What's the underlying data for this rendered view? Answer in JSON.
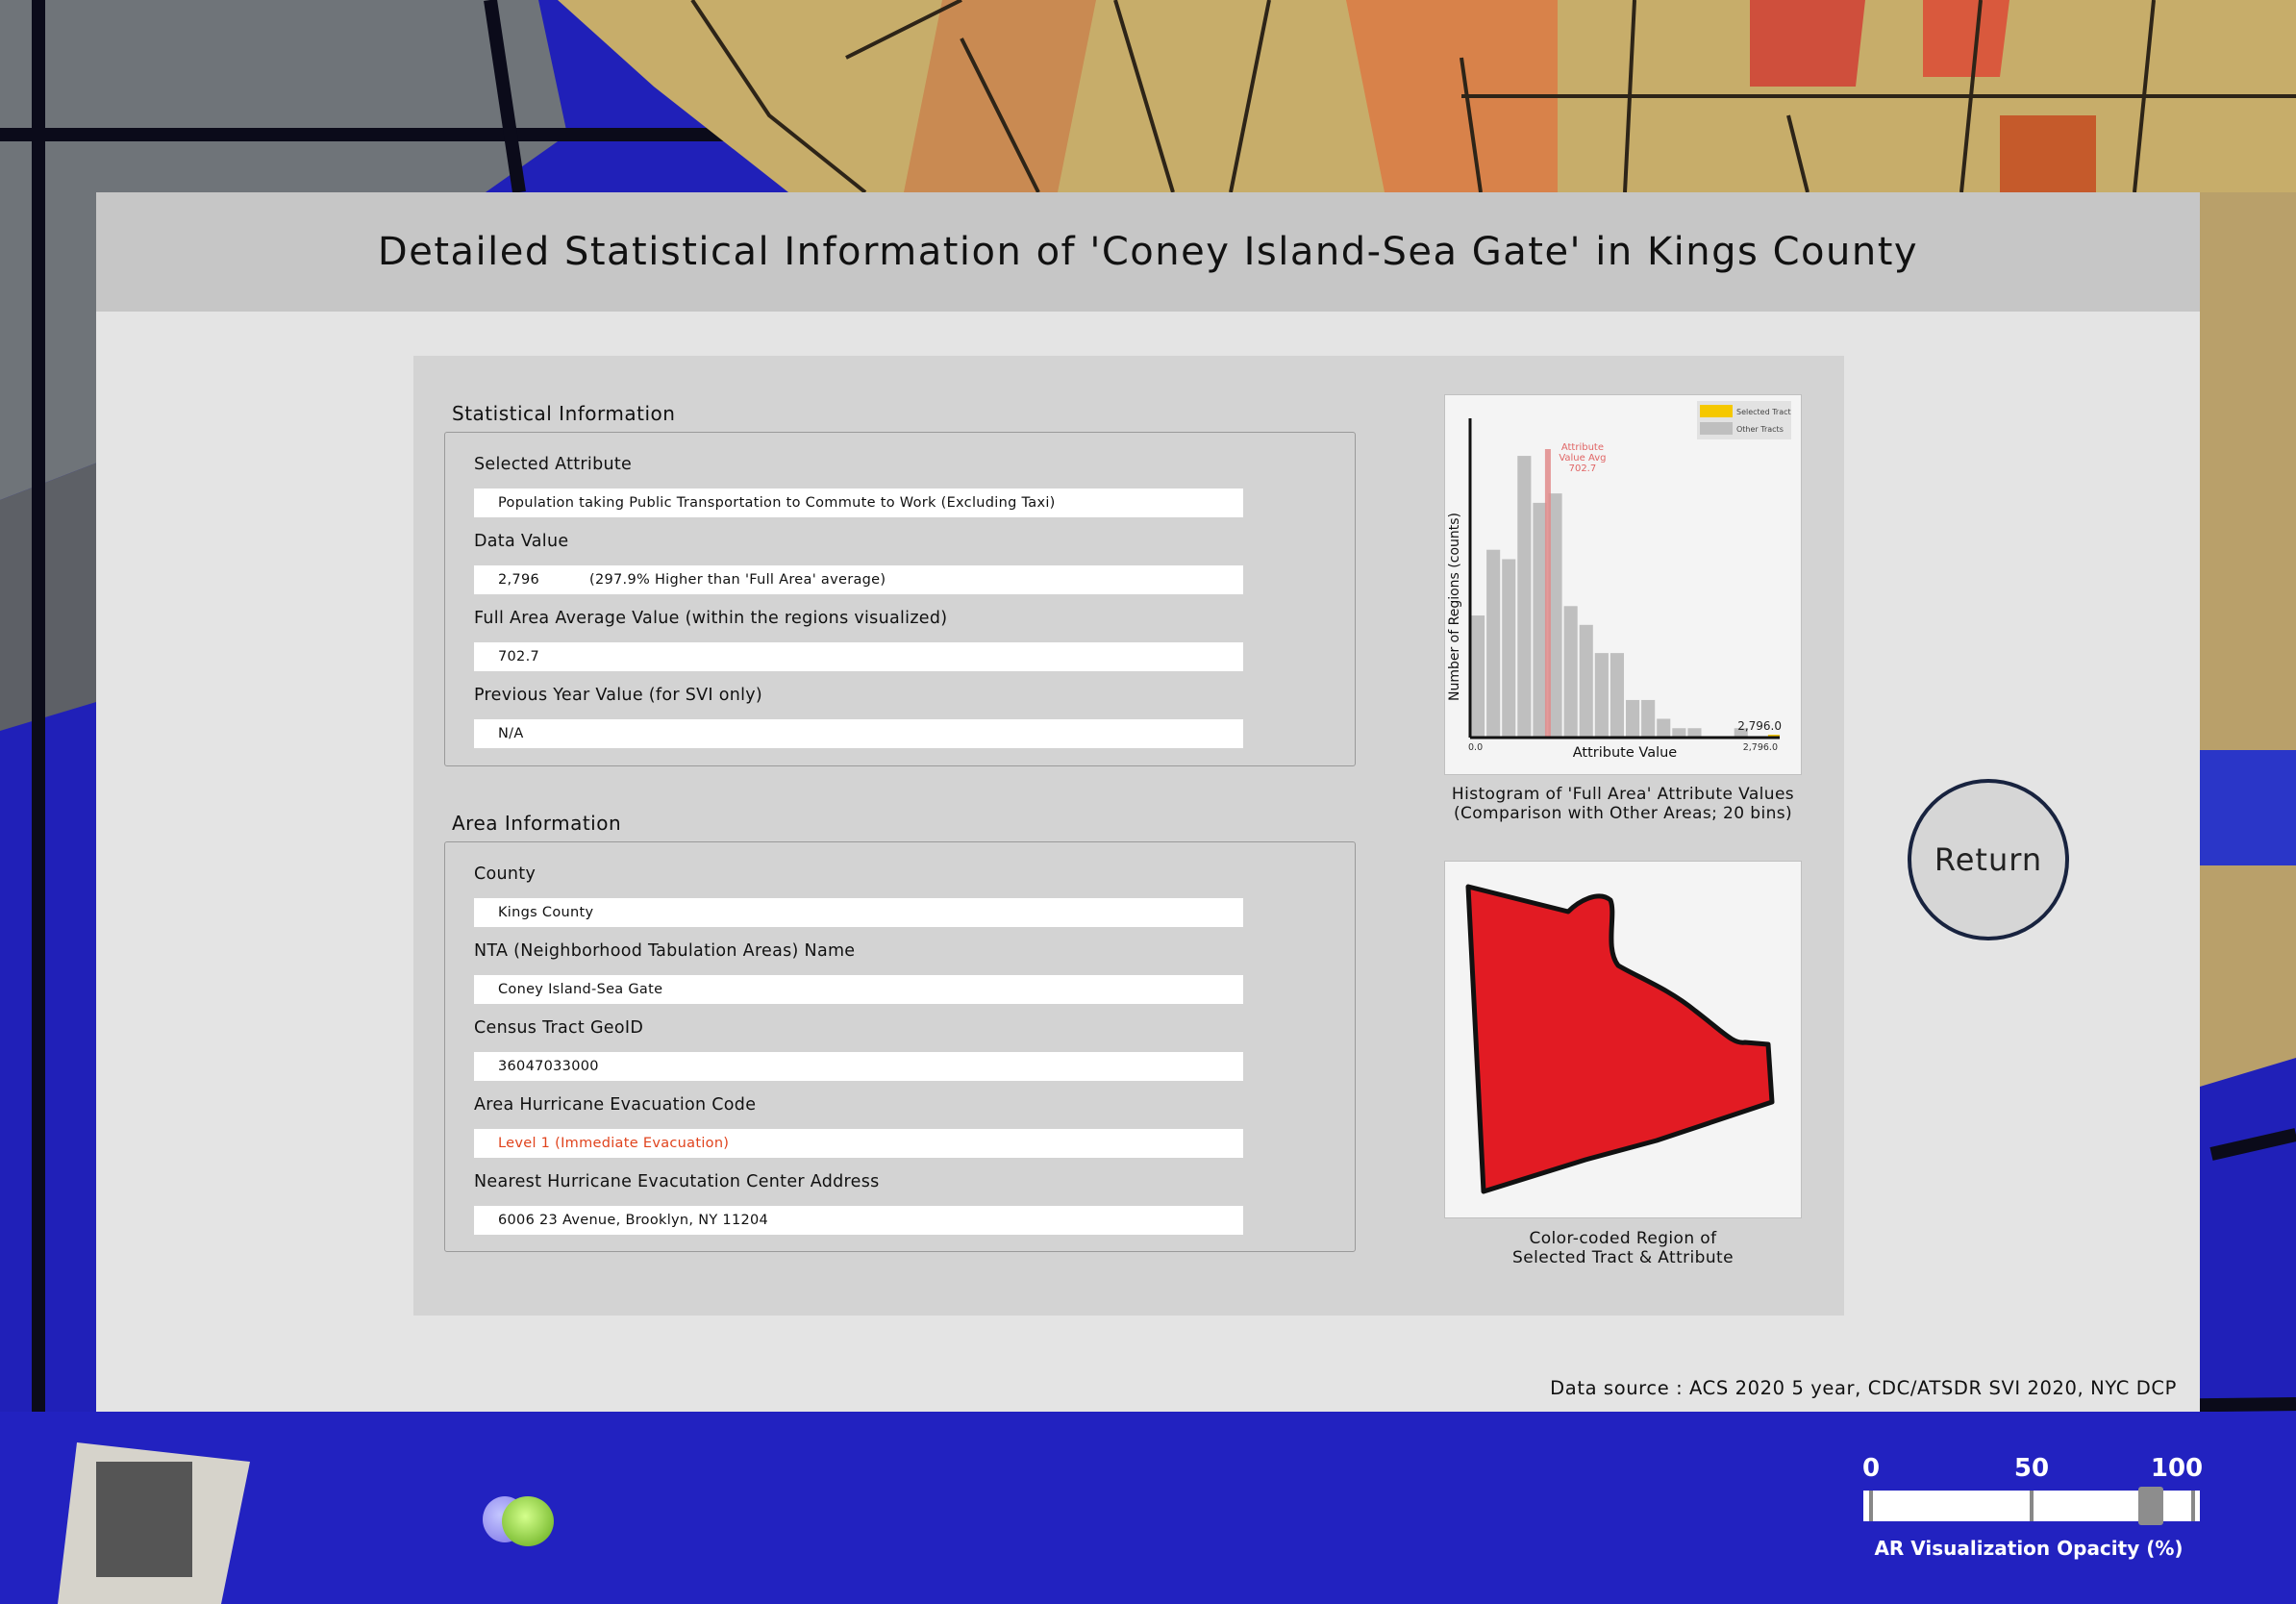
{
  "panel": {
    "title": "Detailed Statistical Information of 'Coney Island-Sea Gate' in Kings County",
    "source": "Data source : ACS 2020 5 year, CDC/ATSDR SVI 2020, NYC DCP"
  },
  "statistical": {
    "section_title": "Statistical Information",
    "selected_attribute_label": "Selected Attribute",
    "selected_attribute_value": "Population taking Public Transportation to Commute to Work (Excluding Taxi)",
    "data_value_label": "Data Value",
    "data_value": "2,796",
    "data_value_comparison": "(297.9% Higher than 'Full Area' average)",
    "full_area_avg_label": "Full Area Average Value (within the regions visualized)",
    "full_area_avg_value": "702.7",
    "previous_year_label": "Previous Year Value (for SVI only)",
    "previous_year_value": "N/A"
  },
  "area": {
    "section_title": "Area Information",
    "county_label": "County",
    "county_value": "Kings County",
    "nta_label": "NTA (Neighborhood Tabulation Areas) Name",
    "nta_value": "Coney Island-Sea Gate",
    "geoid_label": "Census Tract GeoID",
    "geoid_value": "36047033000",
    "evac_code_label": "Area Hurricane Evacuation Code",
    "evac_code_value": "Level 1 (Immediate Evacuation)",
    "evac_center_label": "Nearest Hurricane Evacutation Center Address",
    "evac_center_value": "6006 23 Avenue, Brooklyn, NY 11204"
  },
  "histogram_caption": {
    "line1": "Histogram of 'Full Area' Attribute Values",
    "line2": "(Comparison with Other Areas; 20 bins)"
  },
  "region_caption": {
    "line1": "Color-coded Region of",
    "line2": "Selected Tract & Attribute"
  },
  "return_label": "Return",
  "opacity_slider": {
    "label": "AR Visualization Opacity (%)",
    "ticks": [
      "0",
      "50",
      "100"
    ],
    "value_percent": 87
  },
  "colors": {
    "evac_text": "#e0431d",
    "region_fill": "#e21b23",
    "selected_tract": "#f5c800",
    "avg_line": "#e08a8a",
    "bars": "#bfbfbf"
  },
  "chart_data": {
    "type": "bar",
    "xlabel": "Attribute Value",
    "ylabel": "Number of Regions (counts)",
    "xlim": [
      0.0,
      2796.0
    ],
    "x_tick_labels": [
      "0.0",
      "2,796.0"
    ],
    "bins": 20,
    "values": [
      13,
      20,
      19,
      30,
      25,
      26,
      14,
      12,
      9,
      9,
      4,
      4,
      2,
      1,
      1,
      0,
      0,
      1,
      0,
      0
    ],
    "average": {
      "label_lines": [
        "Attribute",
        "Value Avg",
        "702.7"
      ],
      "value": 702.7
    },
    "selected": {
      "label": "2,796.0",
      "value": 2796.0
    },
    "legend": [
      {
        "name": "Selected Tract",
        "color": "#f5c800"
      },
      {
        "name": "Other Tracts",
        "color": "#bfbfbf"
      }
    ],
    "legend_position": "top-right"
  }
}
